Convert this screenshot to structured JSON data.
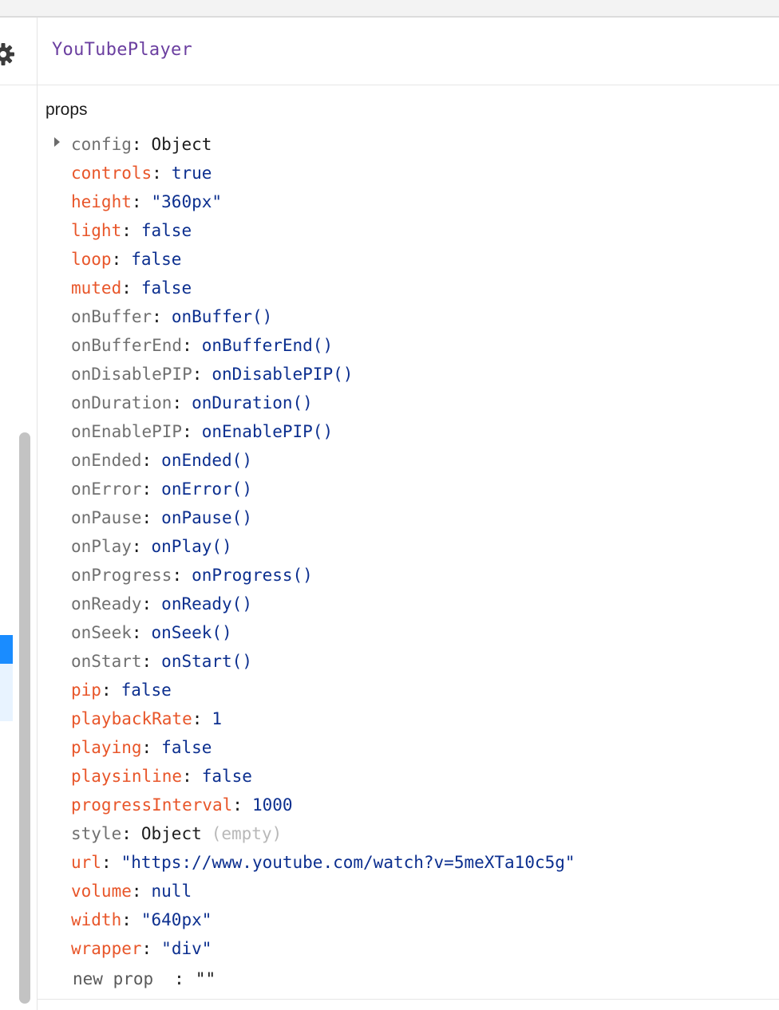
{
  "header": {
    "component_name": "YouTubePlayer",
    "settings_icon": "gear-icon"
  },
  "section_title": "props",
  "props": [
    {
      "key": "config",
      "value": "Object",
      "kind": "readonly",
      "vtype": "obj",
      "expandable": true
    },
    {
      "key": "controls",
      "value": "true",
      "kind": "editable",
      "vtype": "val"
    },
    {
      "key": "height",
      "value": "\"360px\"",
      "kind": "editable",
      "vtype": "val"
    },
    {
      "key": "light",
      "value": "false",
      "kind": "editable",
      "vtype": "val"
    },
    {
      "key": "loop",
      "value": "false",
      "kind": "editable",
      "vtype": "val"
    },
    {
      "key": "muted",
      "value": "false",
      "kind": "editable",
      "vtype": "val"
    },
    {
      "key": "onBuffer",
      "value": "onBuffer()",
      "kind": "readonly",
      "vtype": "val"
    },
    {
      "key": "onBufferEnd",
      "value": "onBufferEnd()",
      "kind": "readonly",
      "vtype": "val"
    },
    {
      "key": "onDisablePIP",
      "value": "onDisablePIP()",
      "kind": "readonly",
      "vtype": "val"
    },
    {
      "key": "onDuration",
      "value": "onDuration()",
      "kind": "readonly",
      "vtype": "val"
    },
    {
      "key": "onEnablePIP",
      "value": "onEnablePIP()",
      "kind": "readonly",
      "vtype": "val"
    },
    {
      "key": "onEnded",
      "value": "onEnded()",
      "kind": "readonly",
      "vtype": "val"
    },
    {
      "key": "onError",
      "value": "onError()",
      "kind": "readonly",
      "vtype": "val"
    },
    {
      "key": "onPause",
      "value": "onPause()",
      "kind": "readonly",
      "vtype": "val"
    },
    {
      "key": "onPlay",
      "value": "onPlay()",
      "kind": "readonly",
      "vtype": "val"
    },
    {
      "key": "onProgress",
      "value": "onProgress()",
      "kind": "readonly",
      "vtype": "val"
    },
    {
      "key": "onReady",
      "value": "onReady()",
      "kind": "readonly",
      "vtype": "val"
    },
    {
      "key": "onSeek",
      "value": "onSeek()",
      "kind": "readonly",
      "vtype": "val"
    },
    {
      "key": "onStart",
      "value": "onStart()",
      "kind": "readonly",
      "vtype": "val"
    },
    {
      "key": "pip",
      "value": "false",
      "kind": "editable",
      "vtype": "val"
    },
    {
      "key": "playbackRate",
      "value": "1",
      "kind": "editable",
      "vtype": "val"
    },
    {
      "key": "playing",
      "value": "false",
      "kind": "editable",
      "vtype": "val"
    },
    {
      "key": "playsinline",
      "value": "false",
      "kind": "editable",
      "vtype": "val"
    },
    {
      "key": "progressInterval",
      "value": "1000",
      "kind": "editable",
      "vtype": "val"
    },
    {
      "key": "style",
      "value": "Object",
      "kind": "readonly",
      "vtype": "obj",
      "note": "(empty)"
    },
    {
      "key": "url",
      "value": "\"https://www.youtube.com/watch?v=5meXTa10c5g\"",
      "kind": "editable",
      "vtype": "val"
    },
    {
      "key": "volume",
      "value": "null",
      "kind": "editable",
      "vtype": "val"
    },
    {
      "key": "width",
      "value": "\"640px\"",
      "kind": "editable",
      "vtype": "val"
    },
    {
      "key": "wrapper",
      "value": "\"div\"",
      "kind": "editable",
      "vtype": "val"
    }
  ],
  "new_prop": {
    "key_placeholder": "new prop",
    "separator": ":",
    "value": "\"\""
  },
  "colors": {
    "editable_key": "#e8562a",
    "readonly_key": "#707070",
    "value": "#0c2f8f",
    "component_name": "#6b3fa0",
    "selection": "#1a8cff"
  }
}
